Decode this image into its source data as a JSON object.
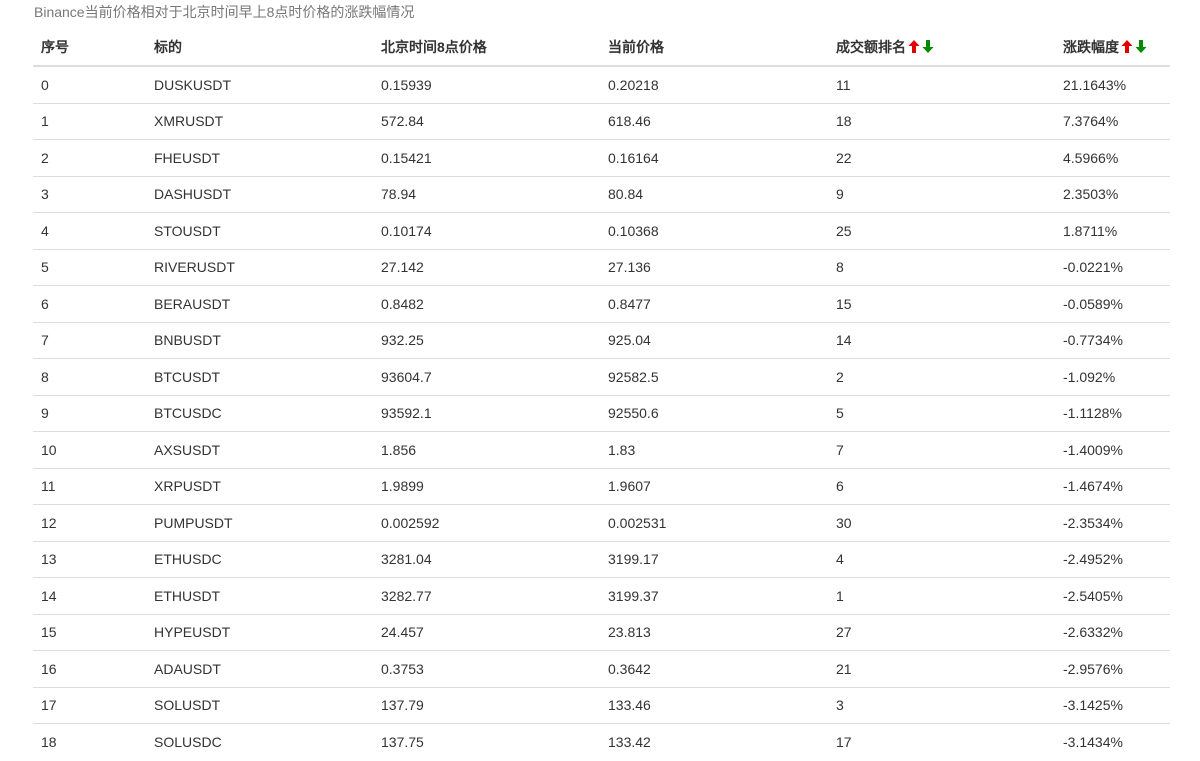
{
  "caption": "Binance当前价格相对于北京时间早上8点时价格的涨跌幅情况",
  "table": {
    "headers": {
      "index": "序号",
      "symbol": "标的",
      "price_8am": "北京时间8点价格",
      "price_now": "当前价格",
      "volume_rank": "成交额排名",
      "change": "涨跌幅度"
    },
    "sort_icons": {
      "up": "arrow-up-icon",
      "down": "arrow-down-icon",
      "up_color": "#e00000",
      "down_color": "#008a00"
    },
    "rows": [
      {
        "index": "0",
        "symbol": "DUSKUSDT",
        "price_8am": "0.15939",
        "price_now": "0.20218",
        "volume_rank": "11",
        "change": "21.1643%"
      },
      {
        "index": "1",
        "symbol": "XMRUSDT",
        "price_8am": "572.84",
        "price_now": "618.46",
        "volume_rank": "18",
        "change": "7.3764%"
      },
      {
        "index": "2",
        "symbol": "FHEUSDT",
        "price_8am": "0.15421",
        "price_now": "0.16164",
        "volume_rank": "22",
        "change": "4.5966%"
      },
      {
        "index": "3",
        "symbol": "DASHUSDT",
        "price_8am": "78.94",
        "price_now": "80.84",
        "volume_rank": "9",
        "change": "2.3503%"
      },
      {
        "index": "4",
        "symbol": "STOUSDT",
        "price_8am": "0.10174",
        "price_now": "0.10368",
        "volume_rank": "25",
        "change": "1.8711%"
      },
      {
        "index": "5",
        "symbol": "RIVERUSDT",
        "price_8am": "27.142",
        "price_now": "27.136",
        "volume_rank": "8",
        "change": "-0.0221%"
      },
      {
        "index": "6",
        "symbol": "BERAUSDT",
        "price_8am": "0.8482",
        "price_now": "0.8477",
        "volume_rank": "15",
        "change": "-0.0589%"
      },
      {
        "index": "7",
        "symbol": "BNBUSDT",
        "price_8am": "932.25",
        "price_now": "925.04",
        "volume_rank": "14",
        "change": "-0.7734%"
      },
      {
        "index": "8",
        "symbol": "BTCUSDT",
        "price_8am": "93604.7",
        "price_now": "92582.5",
        "volume_rank": "2",
        "change": "-1.092%"
      },
      {
        "index": "9",
        "symbol": "BTCUSDC",
        "price_8am": "93592.1",
        "price_now": "92550.6",
        "volume_rank": "5",
        "change": "-1.1128%"
      },
      {
        "index": "10",
        "symbol": "AXSUSDT",
        "price_8am": "1.856",
        "price_now": "1.83",
        "volume_rank": "7",
        "change": "-1.4009%"
      },
      {
        "index": "11",
        "symbol": "XRPUSDT",
        "price_8am": "1.9899",
        "price_now": "1.9607",
        "volume_rank": "6",
        "change": "-1.4674%"
      },
      {
        "index": "12",
        "symbol": "PUMPUSDT",
        "price_8am": "0.002592",
        "price_now": "0.002531",
        "volume_rank": "30",
        "change": "-2.3534%"
      },
      {
        "index": "13",
        "symbol": "ETHUSDC",
        "price_8am": "3281.04",
        "price_now": "3199.17",
        "volume_rank": "4",
        "change": "-2.4952%"
      },
      {
        "index": "14",
        "symbol": "ETHUSDT",
        "price_8am": "3282.77",
        "price_now": "3199.37",
        "volume_rank": "1",
        "change": "-2.5405%"
      },
      {
        "index": "15",
        "symbol": "HYPEUSDT",
        "price_8am": "24.457",
        "price_now": "23.813",
        "volume_rank": "27",
        "change": "-2.6332%"
      },
      {
        "index": "16",
        "symbol": "ADAUSDT",
        "price_8am": "0.3753",
        "price_now": "0.3642",
        "volume_rank": "21",
        "change": "-2.9576%"
      },
      {
        "index": "17",
        "symbol": "SOLUSDT",
        "price_8am": "137.79",
        "price_now": "133.46",
        "volume_rank": "3",
        "change": "-3.1425%"
      },
      {
        "index": "18",
        "symbol": "SOLUSDC",
        "price_8am": "137.75",
        "price_now": "133.42",
        "volume_rank": "17",
        "change": "-3.1434%"
      }
    ]
  }
}
